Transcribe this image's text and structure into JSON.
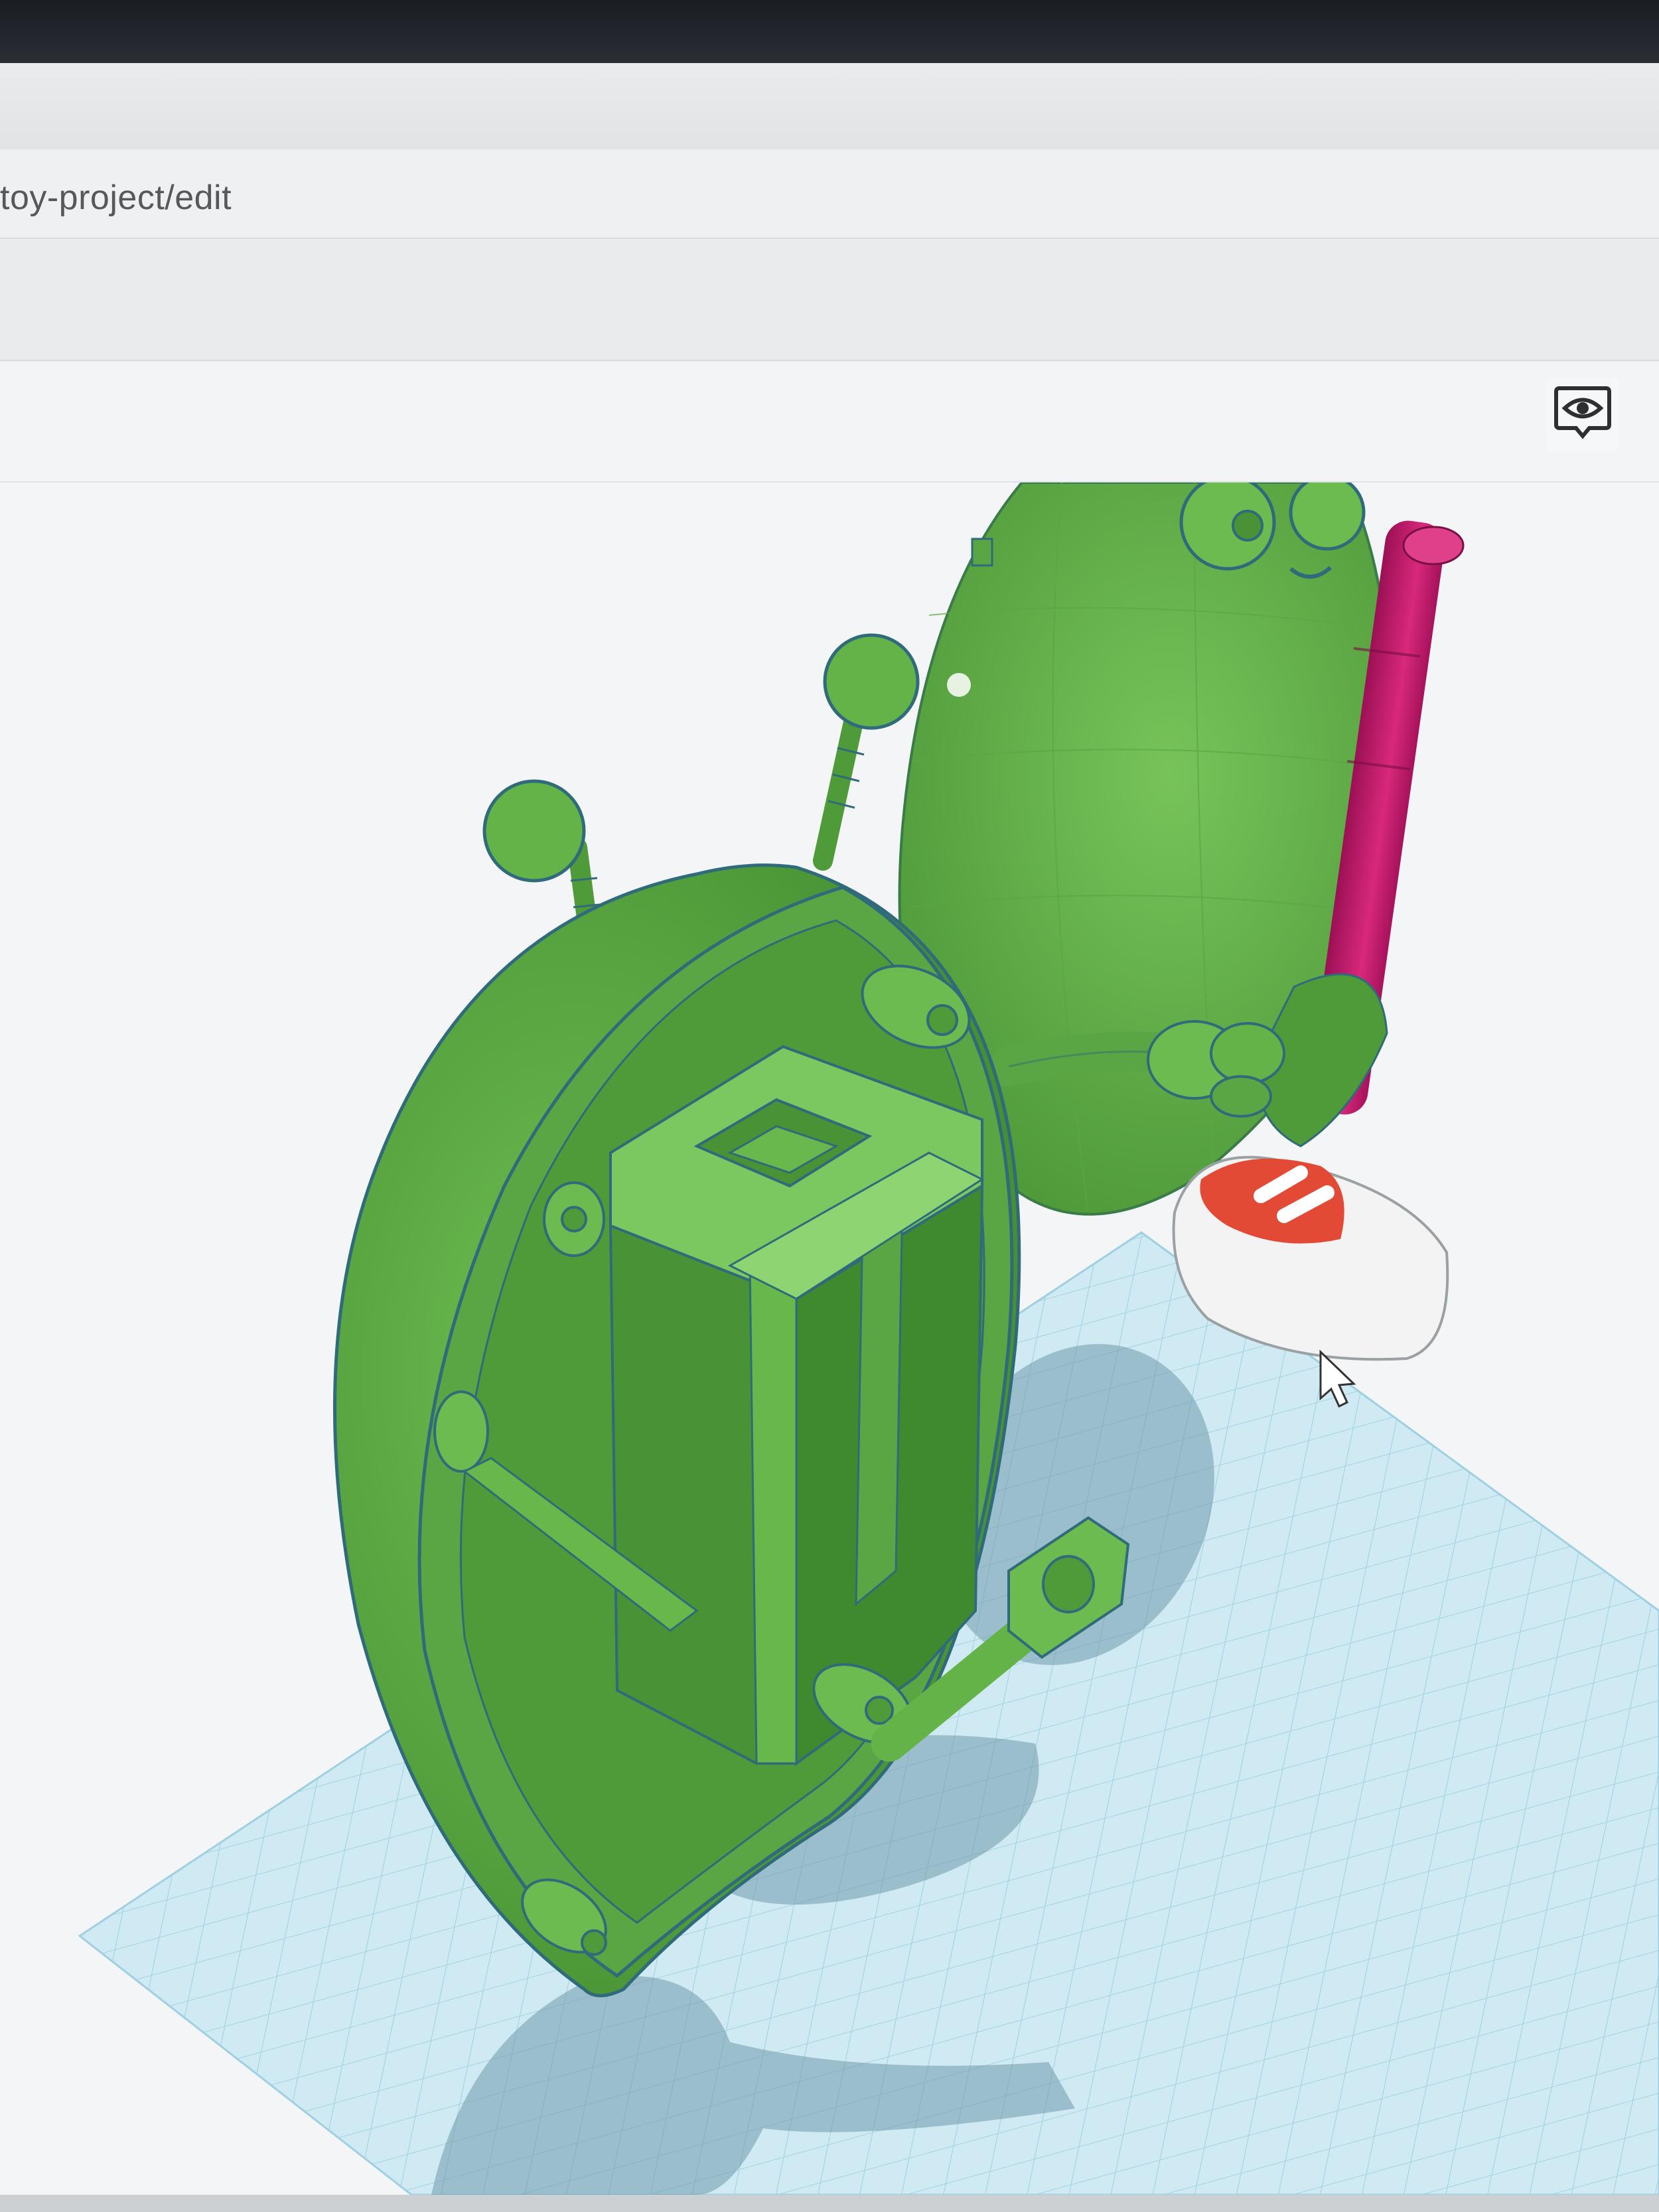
{
  "browser": {
    "url_fragment": "toy-project/edit"
  },
  "app": {
    "view_toggle_icon": "eye-icon",
    "view_toggle_label": ""
  },
  "scene": {
    "model": "green robot toy with opened body shell",
    "workplane": "grid",
    "cursor_icon": "mouse-pointer-icon"
  },
  "colors": {
    "model_green": "#66b84a",
    "model_green_dark": "#4f9a39",
    "outline_blue": "#2f6b7a",
    "rod_magenta": "#c2186b",
    "shoe_red": "#e24a36",
    "shoe_white": "#f2f2f2",
    "grid_blue": "#bfe3f0",
    "grid_line": "#8ecbe0"
  }
}
